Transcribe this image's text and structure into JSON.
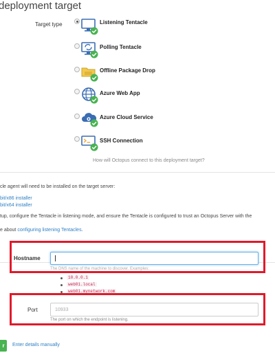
{
  "page": {
    "title": "deployment target"
  },
  "target_type": {
    "label": "Target type",
    "options": [
      {
        "label": "Listening Tentacle",
        "icon": "listening-tentacle-icon",
        "selected": true
      },
      {
        "label": "Polling Tentacle",
        "icon": "polling-tentacle-icon",
        "selected": false
      },
      {
        "label": "Offline Package Drop",
        "icon": "offline-package-drop-icon",
        "selected": false
      },
      {
        "label": "Azure Web App",
        "icon": "azure-web-app-icon",
        "selected": false
      },
      {
        "label": "Azure Cloud Service",
        "icon": "azure-cloud-service-icon",
        "selected": false
      },
      {
        "label": "SSH Connection",
        "icon": "ssh-connection-icon",
        "selected": false
      }
    ],
    "hint": "How will Octopus connect to this deployment target?"
  },
  "instructions": {
    "agent_text": "cle agent will need to be installed on the target server:",
    "link_x86": "bit/x86 installer",
    "link_x64": "bit/x64 installer",
    "setup_text": "tup, configure the Tentacle in listening mode, and ensure the Tentacle is configured to trust an Octopus Server with the",
    "learn_prefix": "e about ",
    "learn_link": "configuring listening Tentacles",
    "learn_suffix": "."
  },
  "hostname": {
    "label": "Hostname",
    "value": "",
    "help_text": "The DNS name of the machine to discover. Examples:",
    "examples": [
      "10.0.0.1",
      "web01.local",
      "web01.mynetwork.com"
    ]
  },
  "port": {
    "label": "Port",
    "placeholder": "10933",
    "help_text": "The port on which the endpoint is listening."
  },
  "actions": {
    "next_label": "r",
    "manual_link": "Enter details manually"
  },
  "colors": {
    "accent": "#2f80c4",
    "highlight": "#e0192a",
    "success": "#48b350"
  }
}
